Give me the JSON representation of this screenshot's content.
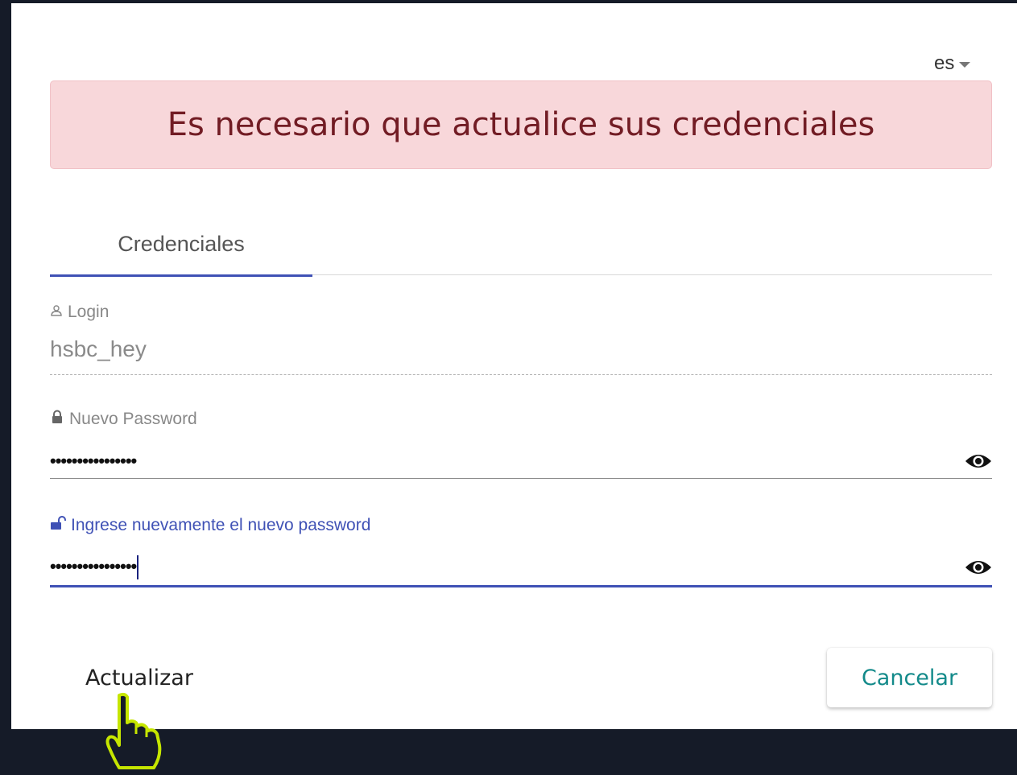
{
  "language": {
    "selected": "es",
    "icon": "chevron-down"
  },
  "alert": {
    "message": "Es necesario que actualice sus credenciales"
  },
  "tabs": [
    {
      "label": "Credenciales",
      "active": true
    }
  ],
  "fields": {
    "login": {
      "label": "Login",
      "value": "hsbc_hey",
      "icon": "user-icon"
    },
    "new_password": {
      "label": "Nuevo Password",
      "value": "••••••••••••••••",
      "icon": "lock-icon"
    },
    "confirm_password": {
      "label": "Ingrese nuevamente el nuevo password",
      "value": "••••••••••••••••",
      "icon": "unlock-icon",
      "focused": true
    }
  },
  "buttons": {
    "update": "Actualizar",
    "cancel": "Cancelar"
  },
  "colors": {
    "accent": "#3f51b5",
    "alert_bg": "#f8d7da",
    "alert_text": "#721c24",
    "cancel_text": "#138a8a",
    "cursor_outline": "#c6e600"
  }
}
